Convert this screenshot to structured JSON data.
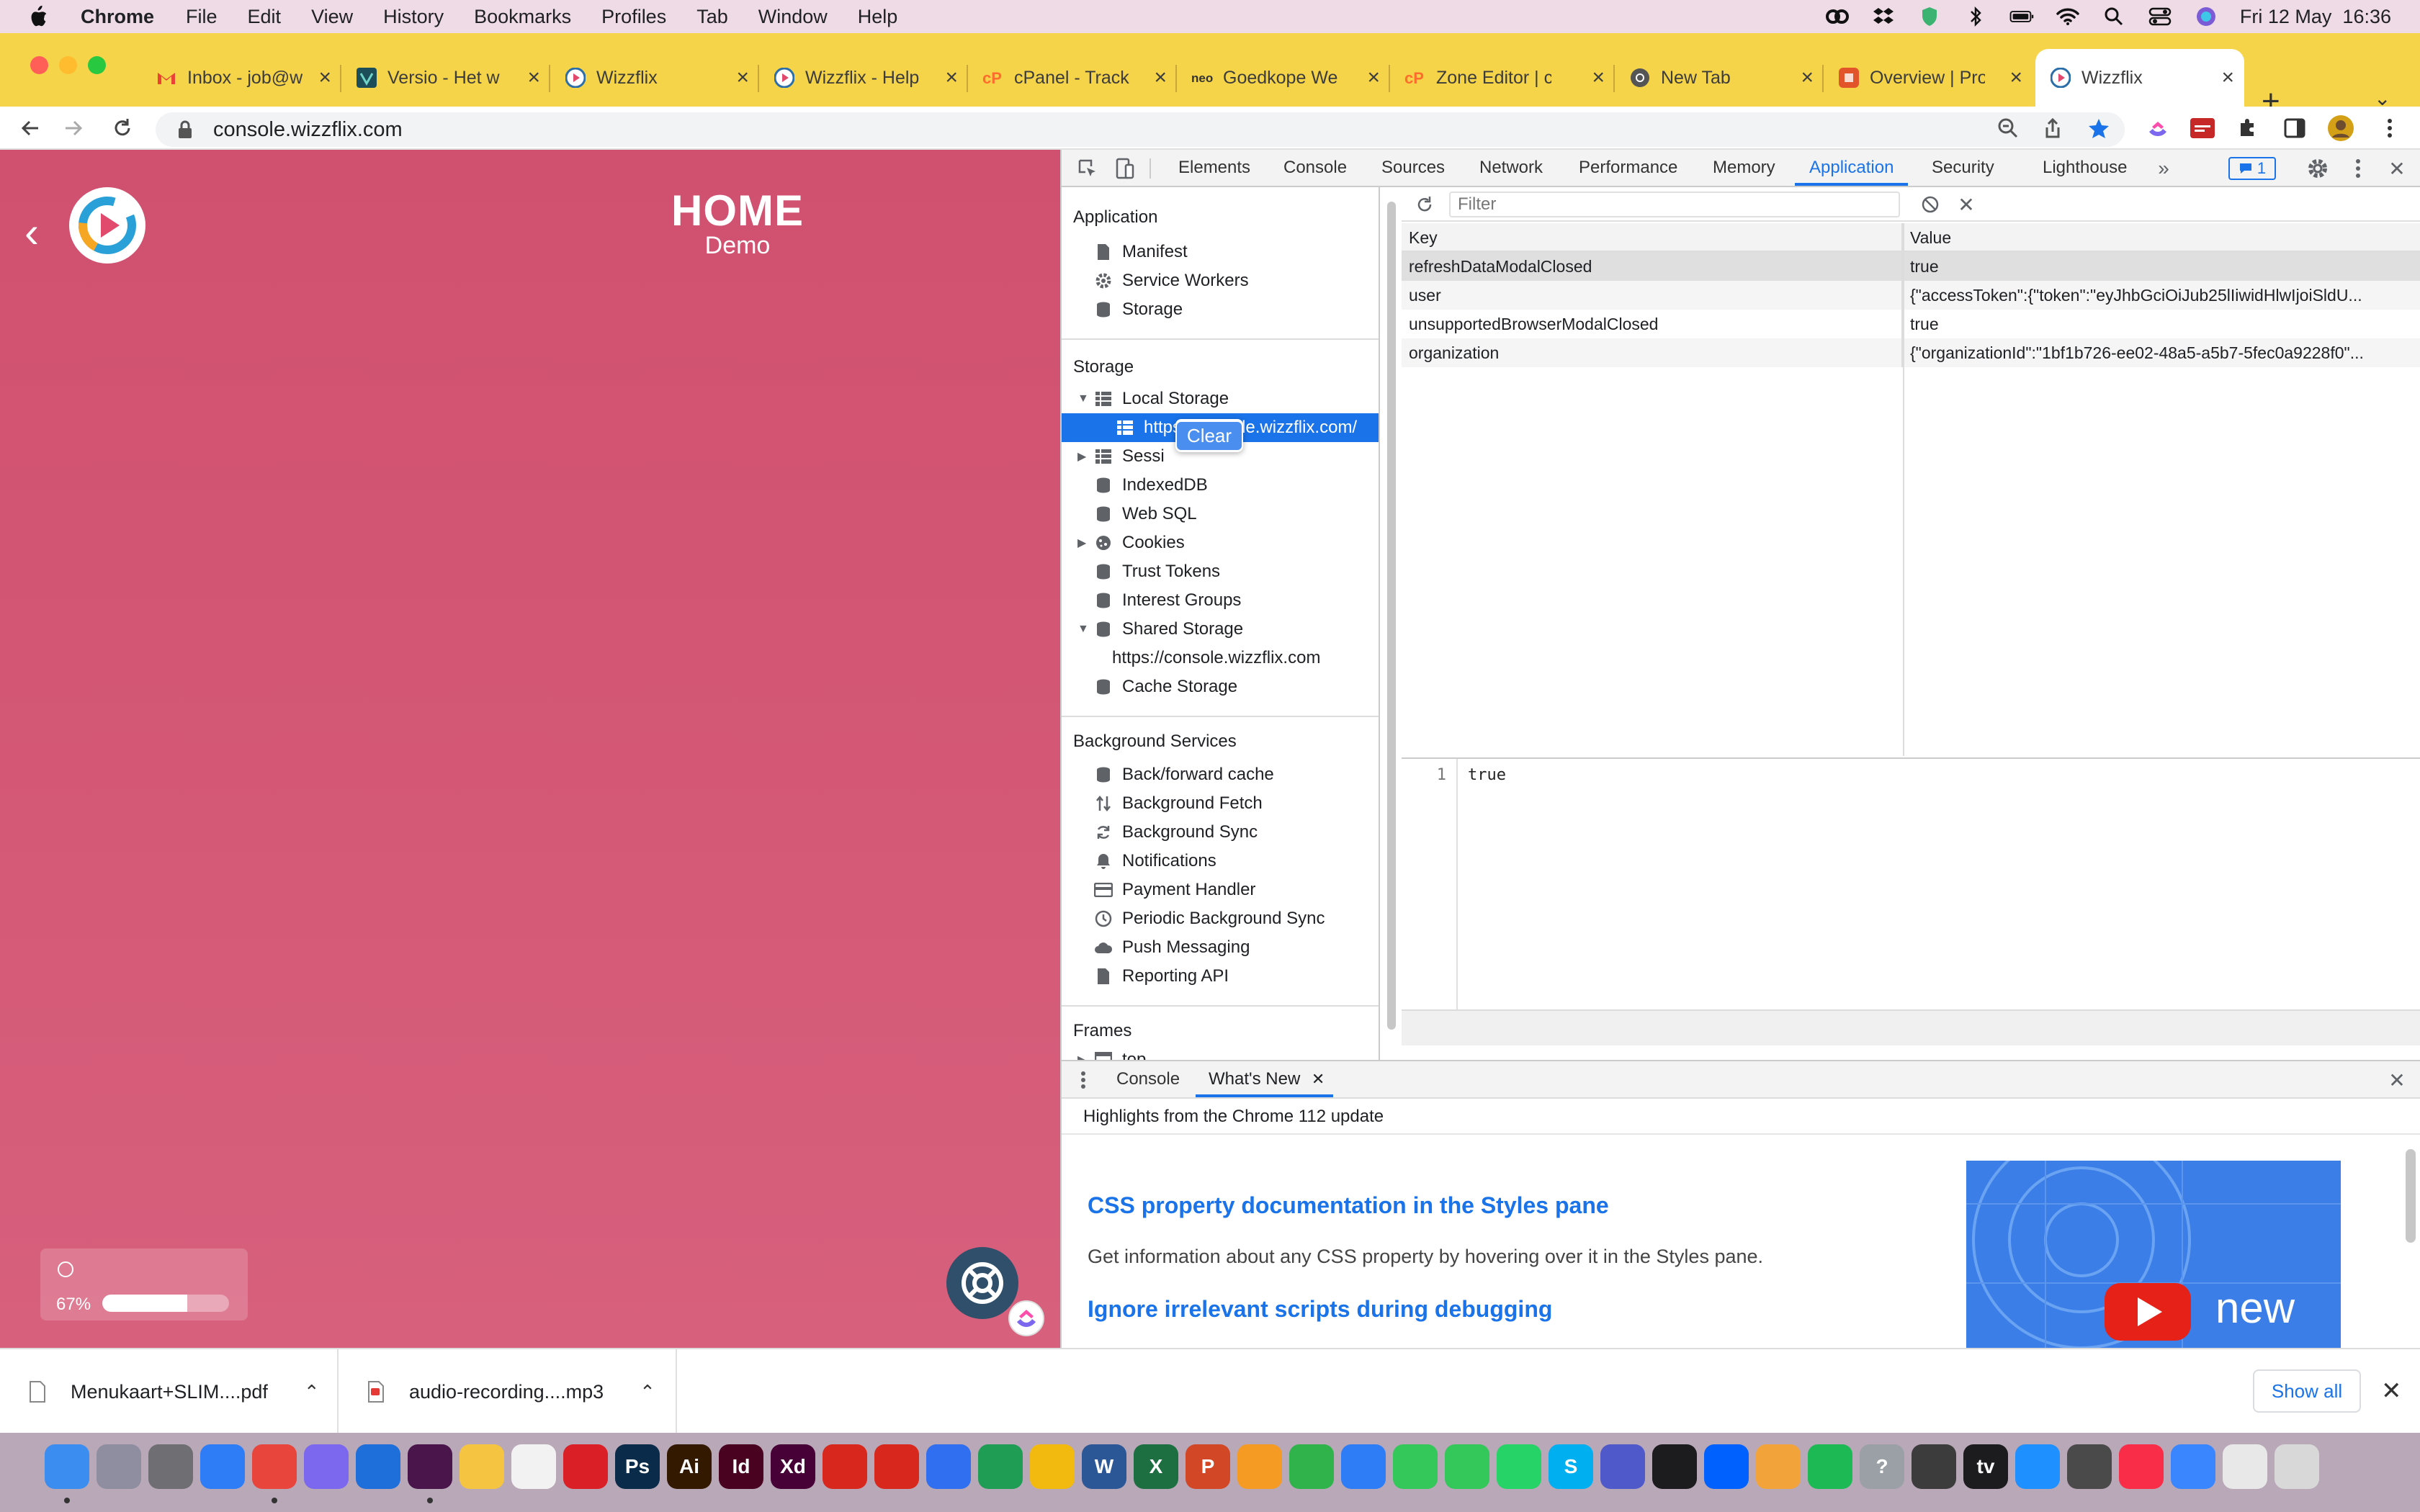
{
  "menubar": {
    "app_name": "Chrome",
    "menus": [
      "File",
      "Edit",
      "View",
      "History",
      "Bookmarks",
      "Profiles",
      "Tab",
      "Window",
      "Help"
    ],
    "datetime": "Fri 12 May  16:36",
    "status_icons": [
      "creative-cloud-icon",
      "dropbox-icon",
      "vpn-shield-icon",
      "bluetooth-icon",
      "battery-icon",
      "wifi-icon",
      "spotlight-icon",
      "control-center-icon",
      "siri-icon"
    ]
  },
  "tabs": [
    {
      "label": "Inbox - job@wi",
      "icon": "gmail-icon"
    },
    {
      "label": "Versio - Het w",
      "icon": "versio-icon"
    },
    {
      "label": "Wizzflix",
      "icon": "wizzflix-icon"
    },
    {
      "label": "Wizzflix - Help",
      "icon": "wizzflix-icon"
    },
    {
      "label": "cPanel - Track",
      "icon": "cpanel-icon"
    },
    {
      "label": "Goedkope Web",
      "icon": "neo-icon"
    },
    {
      "label": "Zone Editor | c",
      "icon": "cpanel-icon"
    },
    {
      "label": "New Tab",
      "icon": "chrome-icon"
    },
    {
      "label": "Overview | Pro",
      "icon": "overview-icon"
    },
    {
      "label": "Wizzflix",
      "icon": "wizzflix-icon",
      "active": true
    }
  ],
  "address": {
    "url": "console.wizzflix.com"
  },
  "page": {
    "title": "HOME",
    "subtitle": "Demo",
    "progress_label": "67%",
    "progress_value": 0.67
  },
  "devtools": {
    "tabs": [
      "Elements",
      "Console",
      "Sources",
      "Network",
      "Performance",
      "Memory",
      "Application",
      "Security",
      "Lighthouse"
    ],
    "active_tab": "Application",
    "issues_count": "1",
    "sidebar": {
      "application_header": "Application",
      "application_items": [
        "Manifest",
        "Service Workers",
        "Storage"
      ],
      "storage_header": "Storage",
      "local_storage": "Local Storage",
      "local_storage_origin": "https://console.wizzflix.com/",
      "session_storage": "Sessi",
      "storage_items": [
        "IndexedDB",
        "Web SQL"
      ],
      "cookies": "Cookies",
      "storage_items_2": [
        "Trust Tokens",
        "Interest Groups"
      ],
      "shared_storage": "Shared Storage",
      "shared_storage_origin": "https://console.wizzflix.com",
      "cache_storage": "Cache Storage",
      "background_header": "Background Services",
      "background_items": [
        "Back/forward cache",
        "Background Fetch",
        "Background Sync",
        "Notifications",
        "Payment Handler",
        "Periodic Background Sync",
        "Push Messaging",
        "Reporting API"
      ],
      "frames_header": "Frames",
      "frames_top": "top"
    },
    "context_menu": {
      "clear": "Clear"
    },
    "filter_placeholder": "Filter",
    "table": {
      "headers": {
        "key": "Key",
        "value": "Value"
      },
      "rows": [
        {
          "key": "refreshDataModalClosed",
          "value": "true"
        },
        {
          "key": "user",
          "value": "{\"accessToken\":{\"token\":\"eyJhbGciOiJub25lIiwidHlwIjoiSldU..."
        },
        {
          "key": "unsupportedBrowserModalClosed",
          "value": "true"
        },
        {
          "key": "organization",
          "value": "{\"organizationId\":\"1bf1b726-ee02-48a5-a5b7-5fec0a9228f0\"..."
        }
      ]
    },
    "preview": {
      "line": "1",
      "code": "true"
    },
    "drawer": {
      "tabs": [
        "Console",
        "What's New"
      ],
      "header": "Highlights from the Chrome 112 update",
      "items": [
        {
          "title": "CSS property documentation in the Styles pane",
          "desc": "Get information about any CSS property by hovering over it in the Styles pane."
        },
        {
          "title": "Ignore irrelevant scripts during debugging",
          "desc": ""
        }
      ],
      "image_text": "new"
    }
  },
  "downloads": {
    "items": [
      "Menukaart+SLIM....pdf",
      "audio-recording....mp3"
    ],
    "show_all": "Show all"
  },
  "dock": {
    "apps": [
      {
        "name": "finder-icon",
        "color": "#3b8df0",
        "label": ""
      },
      {
        "name": "launchpad-icon",
        "color": "#8e8ea0",
        "label": ""
      },
      {
        "name": "system-settings-icon",
        "color": "#6e6e73",
        "label": ""
      },
      {
        "name": "safari-icon",
        "color": "#2f7df6",
        "label": ""
      },
      {
        "name": "chrome-icon",
        "color": "#e8453c",
        "label": ""
      },
      {
        "name": "clickup-icon",
        "color": "#7b68ee",
        "label": ""
      },
      {
        "name": "trello-icon",
        "color": "#1e6fd9",
        "label": ""
      },
      {
        "name": "slack-icon",
        "color": "#4a154b",
        "label": ""
      },
      {
        "name": "notes-icon",
        "color": "#f5c542",
        "label": ""
      },
      {
        "name": "reminders-icon",
        "color": "#f2f2f2",
        "label": ""
      },
      {
        "name": "creative-cloud-icon",
        "color": "#da1f26",
        "label": ""
      },
      {
        "name": "photoshop-icon",
        "color": "#0b2b4a",
        "label": "Ps"
      },
      {
        "name": "illustrator-icon",
        "color": "#331900",
        "label": "Ai"
      },
      {
        "name": "indesign-icon",
        "color": "#49021f",
        "label": "Id"
      },
      {
        "name": "xd-icon",
        "color": "#470137",
        "label": "Xd"
      },
      {
        "name": "acrobat-icon",
        "color": "#d8271c",
        "label": ""
      },
      {
        "name": "acrobat-reader-icon",
        "color": "#d8271c",
        "label": ""
      },
      {
        "name": "docs-icon",
        "color": "#2f6ff0",
        "label": ""
      },
      {
        "name": "sheets-icon",
        "color": "#1f9d55",
        "label": ""
      },
      {
        "name": "slides-icon",
        "color": "#f2b90f",
        "label": ""
      },
      {
        "name": "word-icon",
        "color": "#2b5797",
        "label": "W"
      },
      {
        "name": "excel-icon",
        "color": "#1d6f42",
        "label": "X"
      },
      {
        "name": "powerpoint-icon",
        "color": "#d24726",
        "label": "P"
      },
      {
        "name": "pages-icon",
        "color": "#f59b24",
        "label": ""
      },
      {
        "name": "numbers-icon",
        "color": "#2fb34a",
        "label": ""
      },
      {
        "name": "keynote-icon",
        "color": "#2f7df6",
        "label": ""
      },
      {
        "name": "messages-icon",
        "color": "#34c759",
        "label": ""
      },
      {
        "name": "facetime-icon",
        "color": "#34c759",
        "label": ""
      },
      {
        "name": "whatsapp-icon",
        "color": "#25d366",
        "label": ""
      },
      {
        "name": "skype-icon",
        "color": "#00aff0",
        "label": "S"
      },
      {
        "name": "teams-icon",
        "color": "#5059c9",
        "label": ""
      },
      {
        "name": "voice-memos-icon",
        "color": "#1c1c1e",
        "label": ""
      },
      {
        "name": "dropbox-icon",
        "color": "#0061fe",
        "label": ""
      },
      {
        "name": "photos-icon",
        "color": "#f2a33a",
        "label": ""
      },
      {
        "name": "spotify-icon",
        "color": "#1db954",
        "label": ""
      },
      {
        "name": "help-icon",
        "color": "#9aa0a6",
        "label": "?"
      },
      {
        "name": "app-icon",
        "color": "#3c3c3c",
        "label": ""
      },
      {
        "name": "apple-tv-icon",
        "color": "#1c1c1e",
        "label": "tv"
      },
      {
        "name": "app-store-icon",
        "color": "#1e90ff",
        "label": ""
      },
      {
        "name": "quicktime-icon",
        "color": "#4a4a4a",
        "label": ""
      },
      {
        "name": "music-icon",
        "color": "#fa2d48",
        "label": ""
      },
      {
        "name": "mail-icon",
        "color": "#3a86ff",
        "label": ""
      },
      {
        "name": "preview-icon",
        "color": "#e8e8e8",
        "label": ""
      },
      {
        "name": "trash-icon",
        "color": "#d8d8d8",
        "label": ""
      }
    ]
  },
  "colors": {
    "page_bg": "#d0506f",
    "tabstrip": "#f5d44a",
    "devtools_accent": "#1a73e8"
  }
}
